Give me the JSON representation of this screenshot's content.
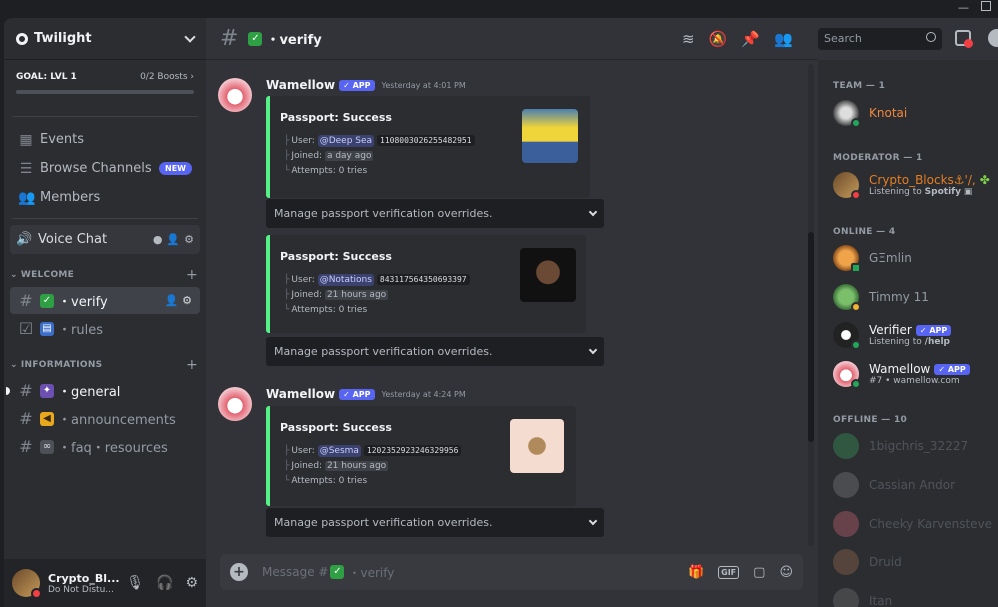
{
  "server": {
    "name": "Twilight"
  },
  "goal": {
    "label": "GOAL: LVL 1",
    "boosts": "0/2 Boosts",
    "progress": 0
  },
  "nav": [
    {
      "label": "Events",
      "icon": "calendar-icon"
    },
    {
      "label": "Browse Channels",
      "icon": "channels-icon",
      "badge": "NEW"
    },
    {
      "label": "Members",
      "icon": "members-icon"
    }
  ],
  "voice": {
    "label": "Voice Chat"
  },
  "categories": {
    "welcome": "WELCOME",
    "informations": "INFORMATIONS"
  },
  "channels": {
    "verify": "・verify",
    "rules": "・rules",
    "general": "・general",
    "announcements": "・announcements",
    "faq": "・faq・resources"
  },
  "user": {
    "name": "Crypto_Bl...",
    "status": "Do Not Distu..."
  },
  "header": {
    "channel": "・verify",
    "search_placeholder": "Search"
  },
  "messages": [
    {
      "author": "Wamellow",
      "badge": "APP",
      "time": "Yesterday at 4:01 PM"
    },
    {
      "author": "Wamellow",
      "badge": "APP",
      "time": "Yesterday at 4:24 PM"
    }
  ],
  "embeds": [
    {
      "title": "Passport: Success",
      "user_label": "User:",
      "mention": "@Deep Sea",
      "id": "1108003026255482951",
      "joined_label": "Joined:",
      "joined": "a day ago",
      "attempts": "Attempts: 0 tries"
    },
    {
      "title": "Passport: Success",
      "user_label": "User:",
      "mention": "@Notations",
      "id": "843117564350693397",
      "joined_label": "Joined:",
      "joined": "21 hours ago",
      "attempts": "Attempts: 0 tries"
    },
    {
      "title": "Passport: Success",
      "user_label": "User:",
      "mention": "@Sesma",
      "id": "1202352923246329956",
      "joined_label": "Joined:",
      "joined": "21 hours ago",
      "attempts": "Attempts: 0 tries"
    }
  ],
  "dropdown_label": "Manage passport verification overrides.",
  "composer": {
    "prefix": "Message #",
    "channel": "・verify"
  },
  "members": {
    "team": "TEAM — 1",
    "moderator": "MODERATOR — 1",
    "online": "ONLINE — 4",
    "offline": "OFFLINE — 10",
    "list": [
      {
        "name": "Knotai",
        "color": "#f0873f"
      },
      {
        "name": "Crypto_Blocks⚓'/,",
        "color": "#e67e22",
        "activity_prefix": "Listening to ",
        "activity_bold": "Spotify"
      },
      {
        "name": "GΞmlin",
        "color": "#949ba4"
      },
      {
        "name": "Timmy 11",
        "color": "#949ba4"
      },
      {
        "name": "Verifier",
        "color": "#f2f3f5",
        "badge": "APP",
        "activity_prefix": "Listening to ",
        "activity_bold": "/help"
      },
      {
        "name": "Wamellow",
        "color": "#f2f3f5",
        "badge": "APP",
        "activity_prefix": "#7 • wamellow.com",
        "activity_bold": ""
      },
      {
        "name": "1bigchris_32227",
        "color": "#949ba4"
      },
      {
        "name": "Cassian Andor",
        "color": "#949ba4"
      },
      {
        "name": "Cheeky Karvensteve",
        "color": "#949ba4"
      },
      {
        "name": "Druid",
        "color": "#949ba4"
      },
      {
        "name": "Itan",
        "color": "#949ba4"
      }
    ]
  }
}
